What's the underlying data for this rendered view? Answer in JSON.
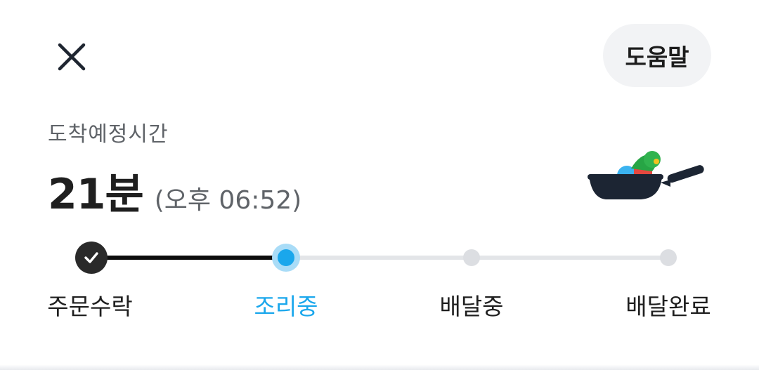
{
  "header": {
    "close_icon": "close-icon",
    "help_label": "도움말"
  },
  "eta": {
    "label": "도착예정시간",
    "minutes_text": "21분",
    "clock_text": "(오후 06:52)"
  },
  "illustration": "frying-pan-with-vegetables",
  "progress": {
    "current_step_index": 1,
    "steps": [
      {
        "label": "주문수락",
        "state": "done"
      },
      {
        "label": "조리중",
        "state": "current"
      },
      {
        "label": "배달중",
        "state": "pending"
      },
      {
        "label": "배달완료",
        "state": "pending"
      }
    ]
  },
  "colors": {
    "accent": "#1aa7ec",
    "done": "#2a2a2a",
    "pending": "#dcdee2"
  }
}
